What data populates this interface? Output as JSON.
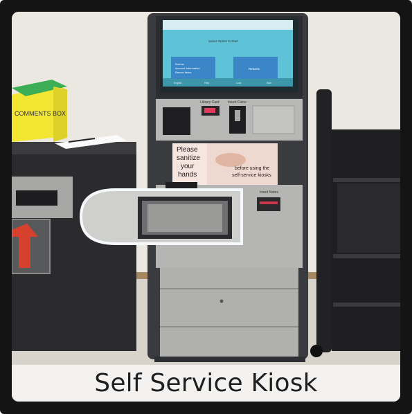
{
  "caption": "Self Service Kiosk",
  "kiosk": {
    "screen": {
      "instruction": "Select Option to Start",
      "left_button": [
        "Borrow",
        "Account Information",
        "Renew Items"
      ],
      "right_button": "Returns",
      "footer": [
        "English",
        "Help",
        "Lock",
        "Start"
      ]
    },
    "card_label": "Library Card",
    "cash_label": "Insert Coins",
    "notes_label": "Insert Notes",
    "sign": {
      "left": [
        "Please",
        "sanitize",
        "your",
        "hands"
      ],
      "right": [
        "before using the",
        "self-service kiosks"
      ]
    }
  },
  "bin": {
    "box_label": "COMMENTS BOX"
  },
  "colors": {
    "wall": "#e9e6e0",
    "floor": "#d9d4cd",
    "kiosk_body": "#b7b8b5",
    "kiosk_dark": "#38393c",
    "screen": "#5fc3d8",
    "yellow_box": "#f3e632",
    "green_lid": "#3cae55",
    "arrow": "#d8402e"
  }
}
